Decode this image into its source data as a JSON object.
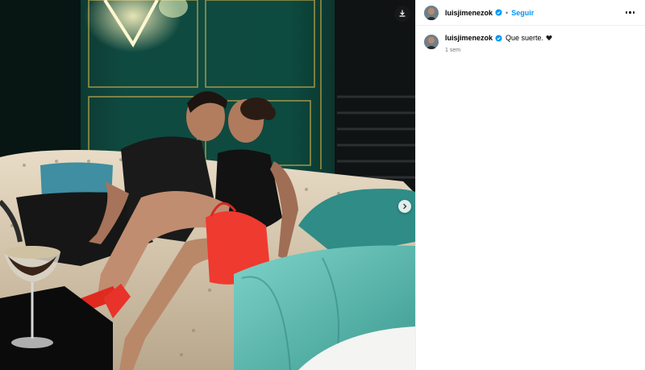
{
  "post": {
    "username": "luisjimenezok",
    "follow_label": "Seguir",
    "separator": "•",
    "caption": "Que suerte.",
    "time": "1 sem"
  },
  "icons": {
    "download": "download-icon",
    "next": "chevron-right-icon",
    "verified": "verified-badge-icon",
    "more": "more-options-icon",
    "heart": "black-heart-icon"
  },
  "colors": {
    "follow": "#0095f6",
    "verified": "#0095f6",
    "muted": "#737373"
  }
}
